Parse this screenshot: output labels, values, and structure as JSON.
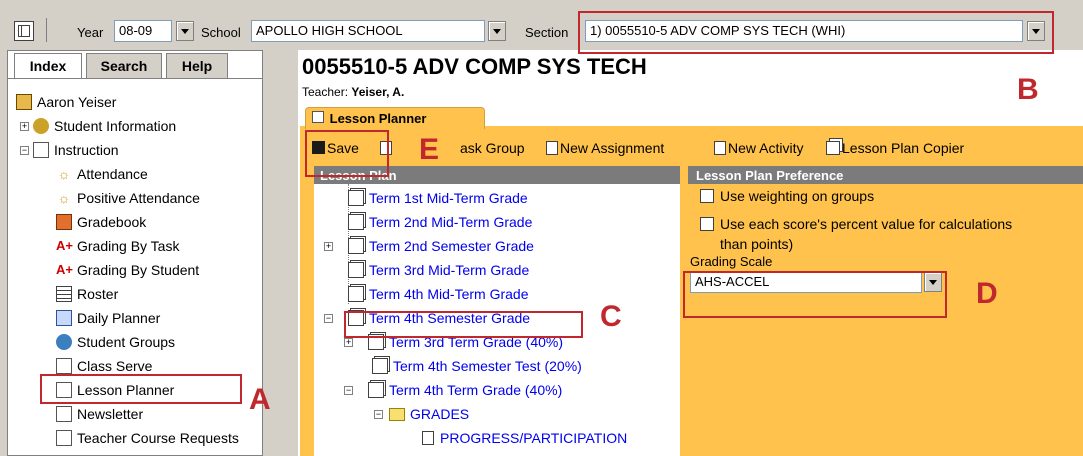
{
  "topbar": {
    "year_label": "Year",
    "year_value": "08-09",
    "school_label": "School",
    "school_value": "APOLLO HIGH SCHOOL",
    "section_label": "Section",
    "section_value": "1) 0055510-5 ADV COMP SYS TECH (WHI)"
  },
  "left": {
    "tabs": [
      "Index",
      "Search",
      "Help"
    ],
    "user": "Aaron Yeiser",
    "items": [
      {
        "label": "Student Information",
        "icon": "student-info-icon"
      },
      {
        "label": "Instruction",
        "icon": "instruction-icon"
      },
      {
        "label": "Attendance",
        "icon": "attendance-icon"
      },
      {
        "label": "Positive Attendance",
        "icon": "positive-attendance-icon"
      },
      {
        "label": "Gradebook",
        "icon": "gradebook-icon"
      },
      {
        "label": "Grading By Task",
        "icon": "grading-task-icon"
      },
      {
        "label": "Grading By Student",
        "icon": "grading-student-icon"
      },
      {
        "label": "Roster",
        "icon": "roster-icon"
      },
      {
        "label": "Daily Planner",
        "icon": "daily-planner-icon"
      },
      {
        "label": "Student Groups",
        "icon": "student-groups-icon"
      },
      {
        "label": "Class Serve",
        "icon": "class-serve-icon"
      },
      {
        "label": "Lesson Planner",
        "icon": "lesson-planner-icon"
      },
      {
        "label": "Newsletter",
        "icon": "newsletter-icon"
      },
      {
        "label": "Teacher Course Requests",
        "icon": "course-requests-icon"
      }
    ]
  },
  "main": {
    "title": "0055510-5 ADV COMP SYS TECH",
    "teacher_label": "Teacher:",
    "teacher_name": "Yeiser, A.",
    "tab_label": "Lesson Planner",
    "toolbar": {
      "save": "Save",
      "task_group": "ask Group",
      "new_assignment": "New Assignment",
      "new_activity": "New Activity",
      "copier": "Lesson Plan Copier"
    },
    "lesson_plan_header": "Lesson Plan",
    "tree": [
      {
        "label": "Term 1st Mid-Term Grade"
      },
      {
        "label": "Term 2nd Mid-Term Grade"
      },
      {
        "label": "Term 2nd Semester Grade"
      },
      {
        "label": "Term 3rd Mid-Term Grade"
      },
      {
        "label": "Term 4th Mid-Term Grade"
      },
      {
        "label": "Term 4th Semester Grade"
      },
      {
        "label": "Term 3rd Term Grade (40%)"
      },
      {
        "label": "Term 4th Semester Test (20%)"
      },
      {
        "label": "Term 4th Term Grade (40%)"
      },
      {
        "label": "GRADES"
      },
      {
        "label": "PROGRESS/PARTICIPATION"
      }
    ],
    "preference": {
      "header": "Lesson Plan Preference",
      "weighting": "Use weighting on groups",
      "percent_line1": "Use each score's percent value for calculations",
      "percent_line2": "than points)",
      "grading_scale_label": "Grading Scale",
      "grading_scale_value": "AHS-ACCEL"
    }
  },
  "markers": [
    "A",
    "B",
    "C",
    "D",
    "E"
  ],
  "colors": {
    "highlight": "#c0282d",
    "tab_orange": "#ffc24d",
    "header_gray": "#7b7b7b",
    "link_blue": "#0000ee"
  }
}
